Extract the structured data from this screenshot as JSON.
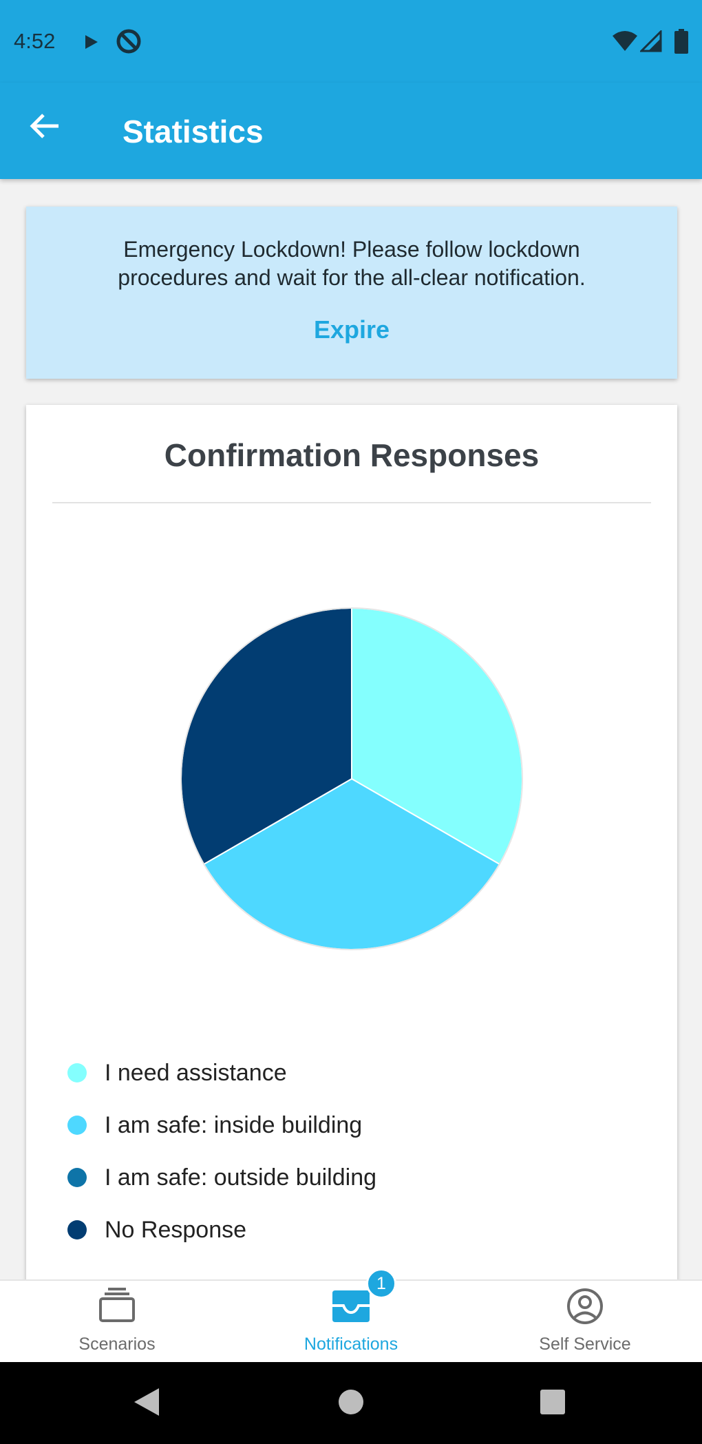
{
  "status_bar": {
    "time": "4:52",
    "icons": [
      "play-icon",
      "do-not-disturb-icon",
      "wifi-icon",
      "signal-icon",
      "battery-icon"
    ]
  },
  "app_bar": {
    "title": "Statistics",
    "back_icon": "arrow-left-icon"
  },
  "alert": {
    "message": "Emergency Lockdown! Please follow lockdown procedures and wait for the all-clear notification.",
    "action_label": "Expire"
  },
  "chart_card": {
    "title": "Confirmation Responses"
  },
  "chart_data": {
    "type": "pie",
    "title": "Confirmation Responses",
    "categories": [
      "I need assistance",
      "I am safe: inside building",
      "I am safe: outside building",
      "No Response"
    ],
    "values": [
      1,
      1,
      0,
      1
    ],
    "colors": [
      "#84fffe",
      "#4ed8ff",
      "#0e74a8",
      "#023d72"
    ],
    "legend_position": "bottom"
  },
  "legend": [
    {
      "label": "I need assistance",
      "color": "#84fffe"
    },
    {
      "label": "I am safe: inside building",
      "color": "#4ed8ff"
    },
    {
      "label": "I am safe: outside building",
      "color": "#0e74a8"
    },
    {
      "label": "No Response",
      "color": "#023d72"
    }
  ],
  "bottom_nav": {
    "items": [
      {
        "label": "Scenarios",
        "icon": "scenarios-icon",
        "active": false
      },
      {
        "label": "Notifications",
        "icon": "inbox-icon",
        "active": true,
        "badge": "1"
      },
      {
        "label": "Self Service",
        "icon": "account-circle-icon",
        "active": false
      }
    ]
  },
  "system_nav": {
    "buttons": [
      "back-triangle-icon",
      "home-circle-icon",
      "recents-square-icon"
    ]
  },
  "colors": {
    "primary": "#1ea7df",
    "alert_background": "#c9e9fb"
  }
}
